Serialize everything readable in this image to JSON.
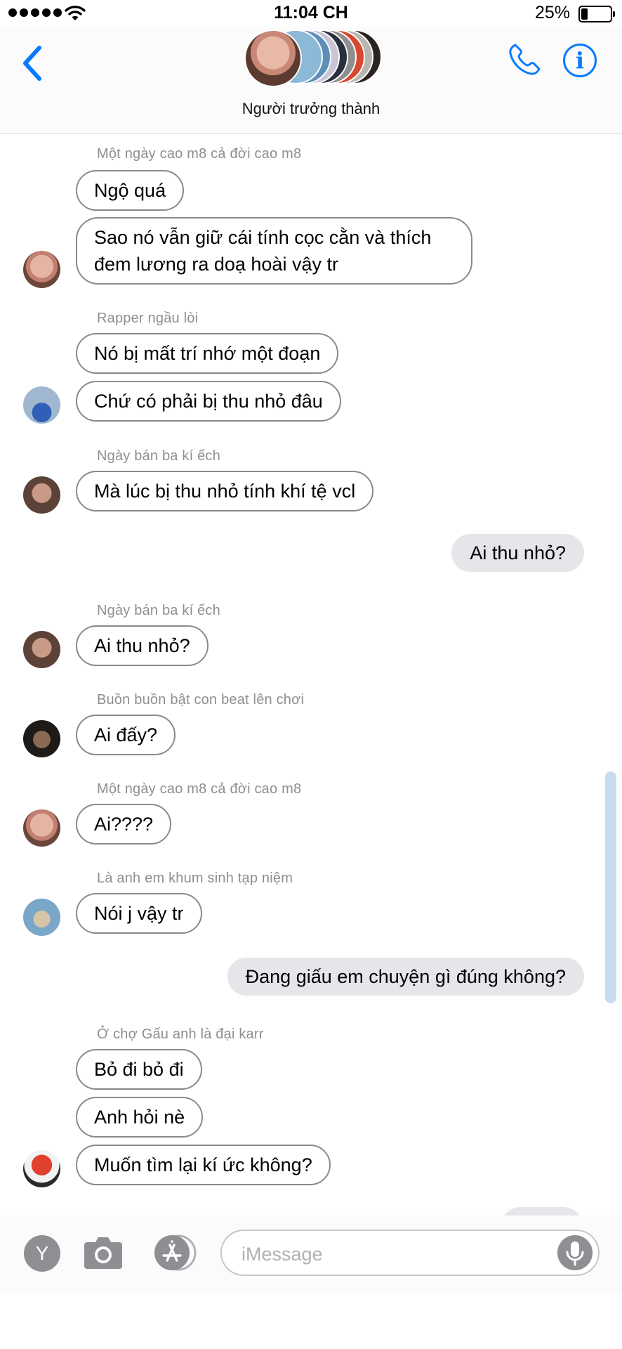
{
  "status_bar": {
    "time": "11:04 CH",
    "battery": "25%"
  },
  "header": {
    "group_name": "Người trưởng thành"
  },
  "messages": [
    {
      "type": "sender",
      "text": "Một ngày cao m8 cả đời cao m8"
    },
    {
      "type": "in",
      "text": "Ngộ quá"
    },
    {
      "type": "in",
      "text": "Sao nó vẫn giữ cái tính cọc cằn và thích đem lương ra doạ hoài vậy tr"
    },
    {
      "type": "sender",
      "text": "Rapper ngầu lòi"
    },
    {
      "type": "in",
      "text": "Nó bị mất trí nhớ một đoạn"
    },
    {
      "type": "in",
      "text": "Chứ có phải bị thu nhỏ đâu"
    },
    {
      "type": "sender",
      "text": "Ngày bán ba kí ếch"
    },
    {
      "type": "in",
      "text": "Mà lúc bị thu nhỏ tính khí tệ vcl"
    },
    {
      "type": "out",
      "text": "Ai thu nhỏ?"
    },
    {
      "type": "sender",
      "text": "Ngày bán ba kí ếch"
    },
    {
      "type": "in",
      "text": "Ai thu nhỏ?"
    },
    {
      "type": "sender",
      "text": "Buồn buồn bật con beat lên chơi"
    },
    {
      "type": "in",
      "text": "Ai đấy?"
    },
    {
      "type": "sender",
      "text": "Một ngày cao m8 cả đời cao m8"
    },
    {
      "type": "in",
      "text": "Ai????"
    },
    {
      "type": "sender",
      "text": "Là anh em khum sinh tạp niệm"
    },
    {
      "type": "in",
      "text": "Nói j vậy tr"
    },
    {
      "type": "out",
      "text": "Đang giấu em chuyện gì đúng không?"
    },
    {
      "type": "sender",
      "text": "Ở chợ Gấu anh là đại karr"
    },
    {
      "type": "in",
      "text": "Bỏ đi bỏ đi"
    },
    {
      "type": "in",
      "text": "Anh hỏi nè"
    },
    {
      "type": "in",
      "text": "Muốn tìm lại kí ức không?"
    }
  ],
  "input_bar": {
    "y_label": "Y",
    "placeholder": "iMessage"
  },
  "colors": {
    "accent": "#0a7aff",
    "outgoing_bubble": "#e5e5ea",
    "incoming_border": "#8a8a8e",
    "sender_text": "#8e8e93"
  }
}
